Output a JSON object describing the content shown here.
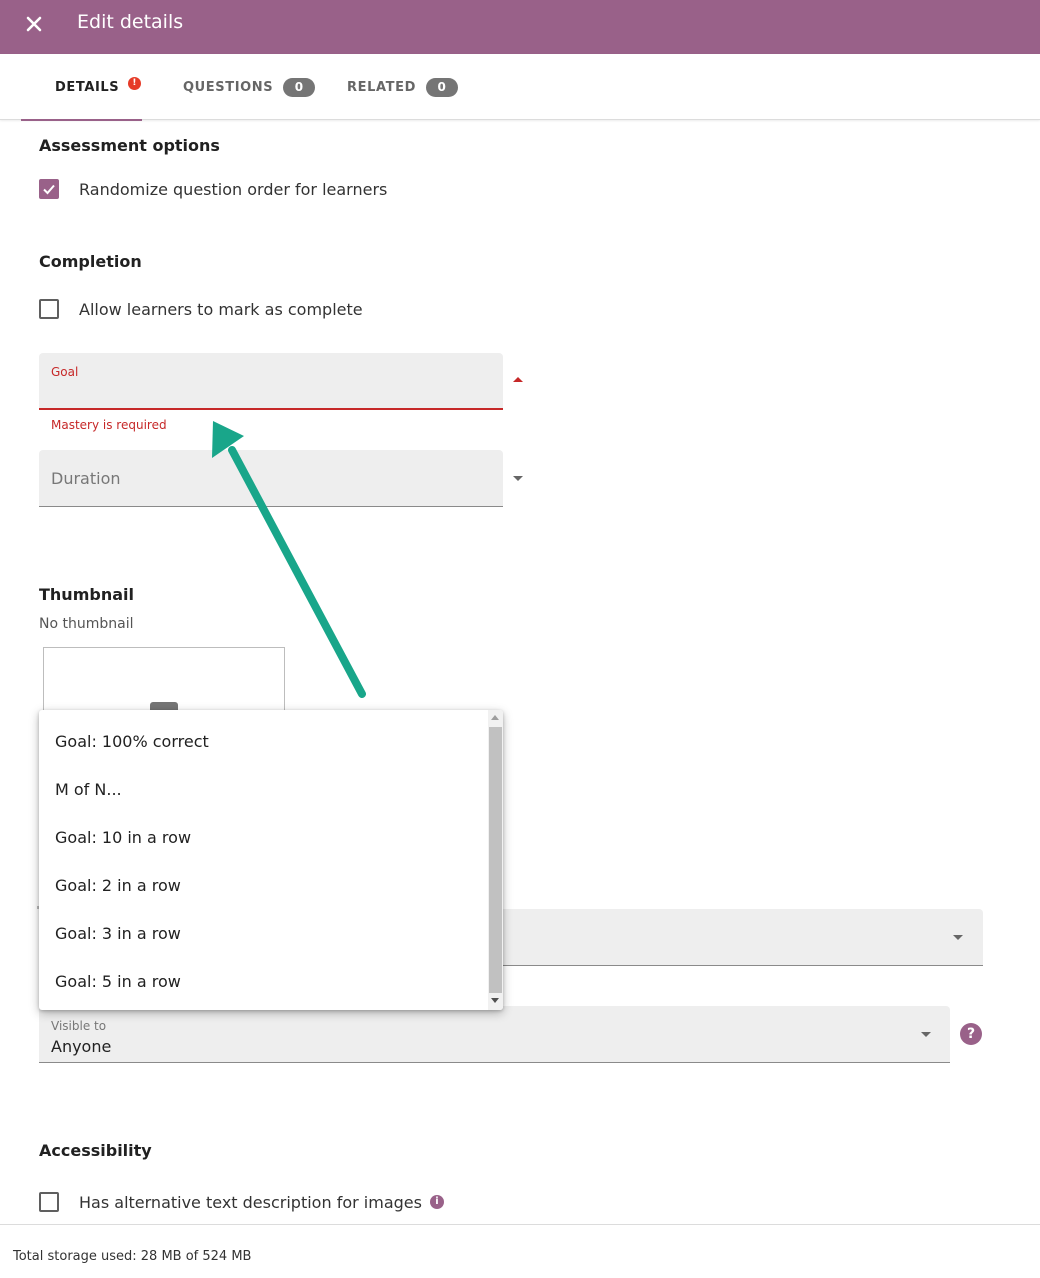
{
  "appbar": {
    "title": "Edit details",
    "close_icon": "close-icon",
    "color": "#996189"
  },
  "tabs": [
    {
      "label": "DETAILS",
      "badge": "!",
      "active": true
    },
    {
      "label": "QUESTIONS",
      "badge": "0",
      "active": false
    },
    {
      "label": "RELATED",
      "badge": "0",
      "active": false
    }
  ],
  "assessment": {
    "heading": "Assessment options",
    "randomize_label": "Randomize question order for learners",
    "randomize_checked": true
  },
  "completion": {
    "heading": "Completion",
    "allow_mark_label": "Allow learners to mark as complete",
    "allow_mark_checked": false,
    "goal": {
      "label": "Goal",
      "value": "",
      "error": "Mastery is required"
    },
    "duration": {
      "label": "Duration"
    }
  },
  "thumbnail": {
    "heading": "Thumbnail",
    "note": "No thumbnail"
  },
  "goal_menu": {
    "options": [
      "Goal: 100% correct",
      "M of N...",
      "Goal: 10 in a row",
      "Goal: 2 in a row",
      "Goal: 3 in a row",
      "Goal: 5 in a row"
    ]
  },
  "visibility": {
    "label": "Visible to",
    "value": "Anyone",
    "help_icon": "help-icon"
  },
  "accessibility": {
    "heading": "Accessibility",
    "alt_text_label": "Has alternative text description for images",
    "alt_text_checked": false,
    "info_icon": "info-icon"
  },
  "footer": {
    "storage": "Total storage used: 28 MB of 524 MB"
  },
  "colors": {
    "accent": "#996189",
    "error": "#c62828",
    "annotation_arrow": "#19a68a"
  }
}
